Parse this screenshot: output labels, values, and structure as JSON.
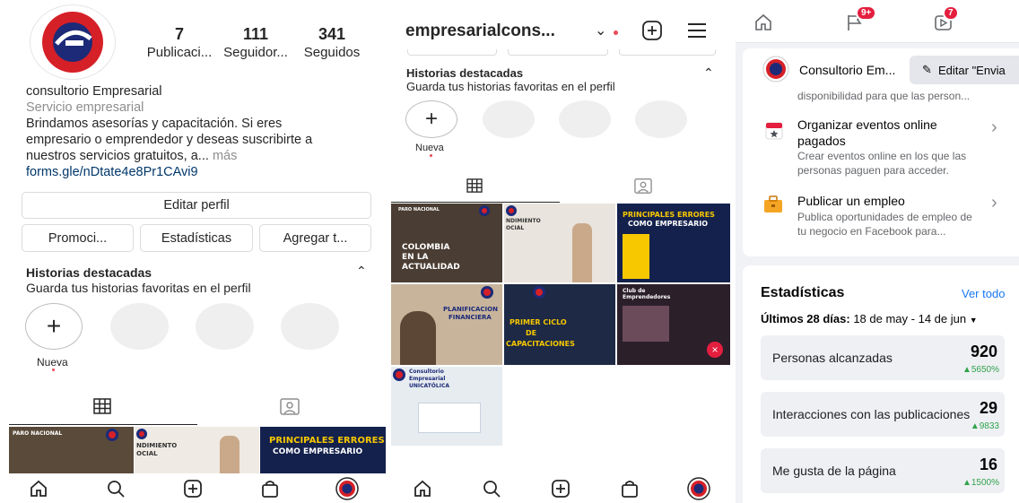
{
  "colors": {
    "brand_red": "#d62027",
    "brand_navy": "#1c2a78",
    "fb_blue": "#1877f2",
    "fb_green": "#31a24c",
    "badge_red": "#e41e3f"
  },
  "profile": {
    "stats": [
      {
        "num": "7",
        "label": "Publicaci..."
      },
      {
        "num": "111",
        "label": "Seguidor..."
      },
      {
        "num": "341",
        "label": "Seguidos"
      }
    ],
    "name": "consultorio Empresarial",
    "category": "Servicio empresarial",
    "bio_line1": "Brindamos asesorías y capacitación. Si eres",
    "bio_line2": "empresario o emprendedor y deseas suscribirte a",
    "bio_line3": "nuestros servicios gratuitos, a...",
    "more": "más",
    "link": "forms.gle/nDtate4e8Pr1CAvi9",
    "edit_profile": "Editar perfil",
    "buttons": [
      "Promoci...",
      "Estadísticas",
      "Agregar t..."
    ],
    "highlights_title": "Historias destacadas",
    "highlights_sub": "Guarda tus historias favoritas en el perfil",
    "new_label": "Nueva"
  },
  "profile2": {
    "username": "empresarialcons...",
    "highlights_title": "Historias destacadas",
    "highlights_sub": "Guarda tus historias favoritas en el perfil",
    "new_label": "Nueva"
  },
  "posts": [
    {
      "title_lines": [
        "COLOMBIA",
        "EN LA",
        "ACTUALIDAD"
      ],
      "header": "PARO NACIONAL"
    },
    {
      "title_lines": [
        "NDIMIENTO",
        "OCIAL"
      ]
    },
    {
      "title_lines": [
        "PRINCIPALES ERRORES",
        "COMO EMPRESARIO"
      ]
    },
    {
      "title_lines": [
        "PLANIFICACION",
        "FINANCIERA"
      ]
    },
    {
      "title_lines": [
        "PRIMER CICLO",
        "DE",
        "CAPACITACIONES"
      ]
    },
    {
      "title_lines": [
        "Club de",
        "Emprendedores"
      ]
    },
    {
      "title_lines": [
        "Consultorio",
        "Empresarial",
        "UNICATÓLICA"
      ]
    }
  ],
  "fb": {
    "badges": {
      "flag": "9+",
      "video": "7"
    },
    "page_name": "Consultorio Em...",
    "edit_button": "Editar \"Envia",
    "truncated_desc": "disponibilidad para que las person...",
    "rows": [
      {
        "title": [
          "Organizar eventos online",
          "pagados"
        ],
        "desc": [
          "Crear eventos online en los que las",
          "personas paguen para acceder."
        ]
      },
      {
        "title": [
          "Publicar un empleo"
        ],
        "desc": [
          "Publica oportunidades de empleo de",
          "tu negocio en Facebook para..."
        ]
      }
    ],
    "stats_title": "Estadísticas",
    "see_all": "Ver todo",
    "period_label": "Últimos 28 días:",
    "period_value": "18 de may - 14 de jun",
    "metrics": [
      {
        "label": "Personas alcanzadas",
        "value": "920",
        "change": "▲5650%"
      },
      {
        "label": "Interacciones con las publicaciones",
        "value": "29",
        "change": "▲9833"
      },
      {
        "label": "Me gusta de la página",
        "value": "16",
        "change": "▲1500%"
      }
    ]
  }
}
